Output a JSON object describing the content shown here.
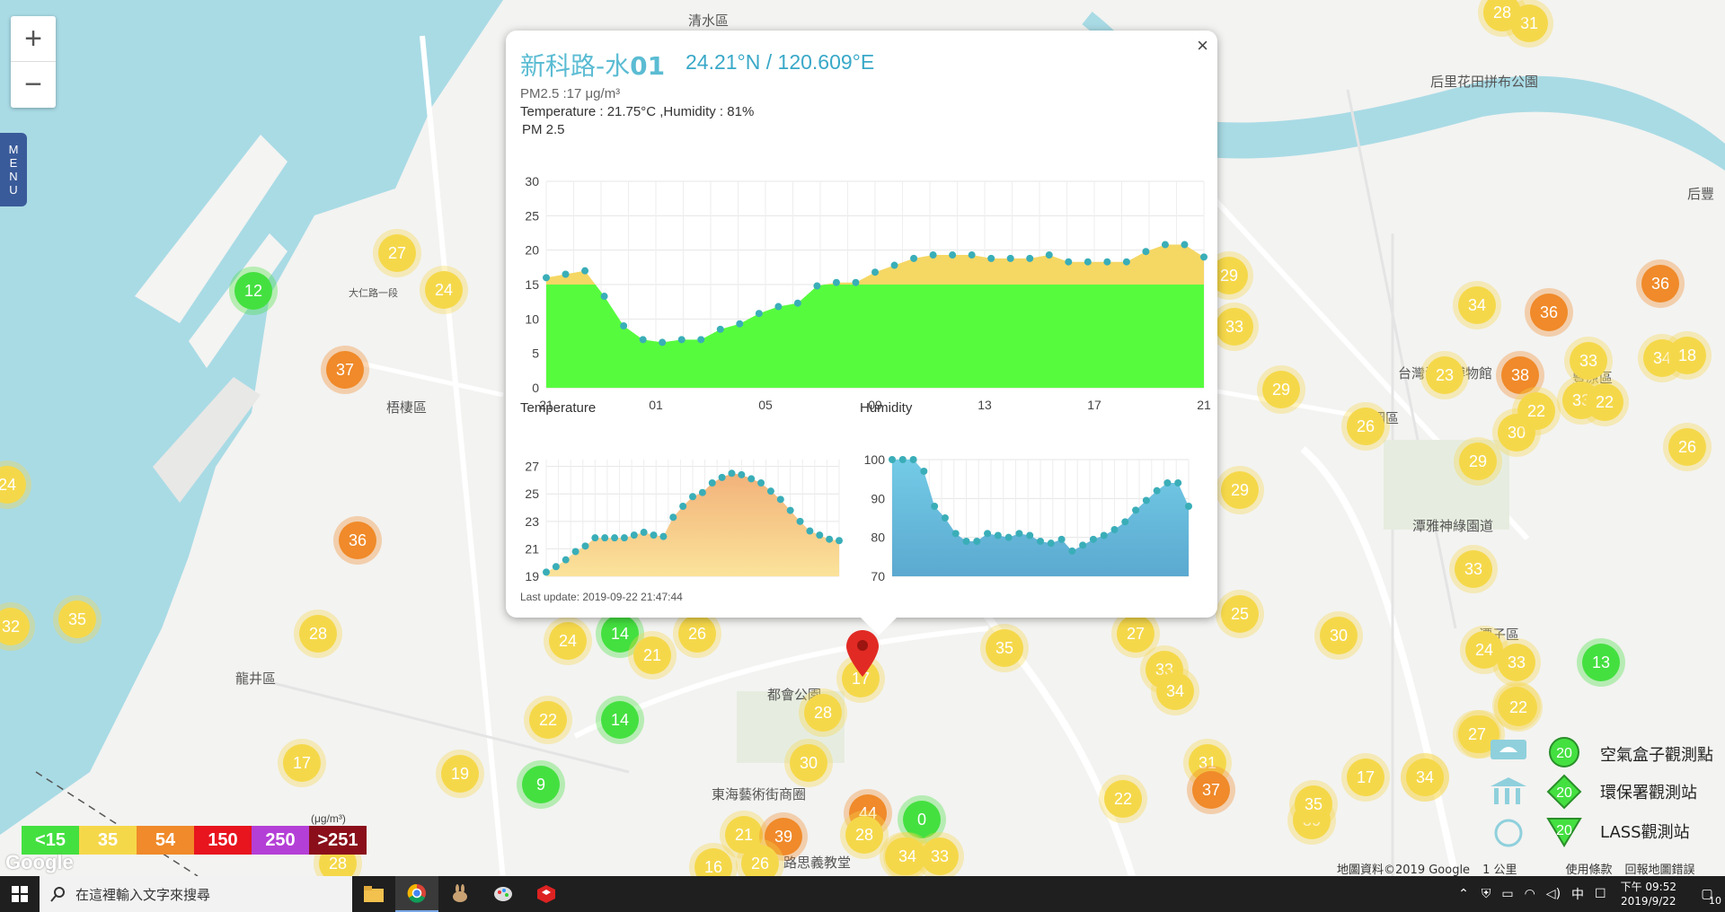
{
  "map": {
    "zoom_in": "+",
    "zoom_out": "−",
    "menu_letters": [
      "M",
      "E",
      "N",
      "U"
    ],
    "places": [
      {
        "name": "清水區"
      },
      {
        "name": "梧棲區"
      },
      {
        "name": "龍井區"
      },
      {
        "name": "都會公園"
      },
      {
        "name": "東海藝術街商圈"
      },
      {
        "name": "后里花田拼布公園"
      },
      {
        "name": "神岡區"
      },
      {
        "name": "潭雅神綠園道"
      },
      {
        "name": "潭子區"
      },
      {
        "name": "台灣滑翔博物館"
      },
      {
        "name": "豐原區"
      },
      {
        "name": "后豐"
      },
      {
        "name": "大仁路一段"
      },
      {
        "name": "路思義教堂"
      }
    ],
    "legend": {
      "unit": "(μg/m³)",
      "items": [
        {
          "label": "<15",
          "color": "#44e040"
        },
        {
          "label": "35",
          "color": "#f5d84a"
        },
        {
          "label": "54",
          "color": "#f08a2a"
        },
        {
          "label": "150",
          "color": "#e8141e"
        },
        {
          "label": "250",
          "color": "#b43fd6"
        },
        {
          "label": ">251",
          "color": "#8a0f1a"
        }
      ]
    },
    "station_legend": {
      "items": [
        {
          "value": "20",
          "label": "空氣盒子觀測點"
        },
        {
          "value": "20",
          "label": "環保署觀測站"
        },
        {
          "value": "20",
          "label": "LASS觀測站"
        }
      ]
    },
    "attribution": "Google",
    "map_data": "地圖資料©2019 Google",
    "scale": "1 公里",
    "terms": "使用條款",
    "report": "回報地圖錯誤",
    "markers": [
      {
        "v": "31",
        "c": "y"
      },
      {
        "v": "28",
        "c": "y"
      },
      {
        "v": "27",
        "c": "y"
      },
      {
        "v": "24",
        "c": "y"
      },
      {
        "v": "12",
        "c": "g"
      },
      {
        "v": "37",
        "c": "o"
      },
      {
        "v": "24",
        "c": "y"
      },
      {
        "v": "36",
        "c": "o"
      },
      {
        "v": "32",
        "c": "y"
      },
      {
        "v": "35",
        "c": "y"
      },
      {
        "v": "28",
        "c": "y"
      },
      {
        "v": "17",
        "c": "y"
      },
      {
        "v": "28",
        "c": "y"
      },
      {
        "v": "24",
        "c": "y"
      },
      {
        "v": "14",
        "c": "g"
      },
      {
        "v": "21",
        "c": "y"
      },
      {
        "v": "26",
        "c": "y"
      },
      {
        "v": "22",
        "c": "y"
      },
      {
        "v": "14",
        "c": "g"
      },
      {
        "v": "19",
        "c": "y"
      },
      {
        "v": "9",
        "c": "g"
      },
      {
        "v": "17",
        "c": "y"
      },
      {
        "v": "28",
        "c": "y"
      },
      {
        "v": "30",
        "c": "y"
      },
      {
        "v": "21",
        "c": "y"
      },
      {
        "v": "39",
        "c": "o"
      },
      {
        "v": "44",
        "c": "o"
      },
      {
        "v": "28",
        "c": "y"
      },
      {
        "v": "0",
        "c": "g"
      },
      {
        "v": "33",
        "c": "y"
      },
      {
        "v": "34",
        "c": "y"
      },
      {
        "v": "33",
        "c": "y"
      },
      {
        "v": "26",
        "c": "y"
      },
      {
        "v": "16",
        "c": "y"
      },
      {
        "v": "35",
        "c": "y"
      },
      {
        "v": "27",
        "c": "y"
      },
      {
        "v": "33",
        "c": "y"
      },
      {
        "v": "34",
        "c": "y"
      },
      {
        "v": "25",
        "c": "y"
      },
      {
        "v": "31",
        "c": "y"
      },
      {
        "v": "37",
        "c": "o"
      },
      {
        "v": "22",
        "c": "y"
      },
      {
        "v": "30",
        "c": "y"
      },
      {
        "v": "35",
        "c": "y"
      },
      {
        "v": "17",
        "c": "y"
      },
      {
        "v": "34",
        "c": "y"
      },
      {
        "v": "27",
        "c": "y"
      },
      {
        "v": "22",
        "c": "y"
      },
      {
        "v": "29",
        "c": "y"
      },
      {
        "v": "33",
        "c": "y"
      },
      {
        "v": "34",
        "c": "y"
      },
      {
        "v": "36",
        "c": "o"
      },
      {
        "v": "23",
        "c": "y"
      },
      {
        "v": "29",
        "c": "y"
      },
      {
        "v": "36",
        "c": "o"
      },
      {
        "v": "34",
        "c": "y"
      },
      {
        "v": "38",
        "c": "o"
      },
      {
        "v": "33",
        "c": "y"
      },
      {
        "v": "33",
        "c": "y"
      },
      {
        "v": "22",
        "c": "y"
      },
      {
        "v": "18",
        "c": "y"
      },
      {
        "v": "26",
        "c": "y"
      },
      {
        "v": "30",
        "c": "y"
      },
      {
        "v": "22",
        "c": "y"
      },
      {
        "v": "29",
        "c": "y"
      },
      {
        "v": "29",
        "c": "y"
      },
      {
        "v": "26",
        "c": "y"
      },
      {
        "v": "33",
        "c": "y"
      },
      {
        "v": "24",
        "c": "y"
      },
      {
        "v": "33",
        "c": "y"
      },
      {
        "v": "13",
        "c": "g"
      },
      {
        "v": "22",
        "c": "y"
      },
      {
        "v": "27",
        "c": "y"
      },
      {
        "v": "34",
        "c": "y"
      },
      {
        "v": "30",
        "c": "y"
      }
    ]
  },
  "popup": {
    "name": "新科路-水",
    "name_bold": "01",
    "coords": "24.21°N / 120.609°E",
    "pm_line": "PM2.5 :17 μg/m³",
    "th_line": "Temperature : 21.75°C ,Humidity : 81%",
    "close": "×",
    "last_update": "Last update: 2019-09-22 21:47:44",
    "pm_chart_label": "PM 2.5",
    "temp_chart_label": "Temperature",
    "hum_chart_label": "Humidity"
  },
  "chart_data": [
    {
      "type": "area",
      "title": "PM 2.5",
      "x_tick_labels": [
        "21",
        "01",
        "05",
        "09",
        "13",
        "17",
        "21"
      ],
      "y_ticks": [
        0,
        5,
        10,
        15,
        20,
        25,
        30
      ],
      "ylim": [
        0,
        30
      ],
      "threshold": 15,
      "colors": {
        "below": "#57fb3e",
        "above": "#f5d764",
        "points": "#3aaeb8"
      },
      "values": [
        16,
        16.5,
        17,
        13.3,
        9,
        7,
        6.6,
        7,
        7,
        8.5,
        9.3,
        10.8,
        11.8,
        12.3,
        14.8,
        15.3,
        15.3,
        16.8,
        17.8,
        18.8,
        19.3,
        19.3,
        19.3,
        18.8,
        18.8,
        18.8,
        19.3,
        18.3,
        18.3,
        18.3,
        18.3,
        19.8,
        20.8,
        20.8,
        19
      ]
    },
    {
      "type": "area",
      "title": "Temperature",
      "y_ticks": [
        19,
        21,
        23,
        25,
        27
      ],
      "ylim": [
        19,
        27.5
      ],
      "colors": {
        "fill_top": "#f2b27a",
        "fill_bottom": "#fbe39a",
        "points": "#3aaeb8"
      },
      "values": [
        19.3,
        19.7,
        20.2,
        20.8,
        21.2,
        21.8,
        21.8,
        21.8,
        21.8,
        22,
        22.2,
        22,
        21.9,
        23.3,
        24.1,
        24.8,
        25.1,
        25.8,
        26.2,
        26.5,
        26.4,
        26.1,
        25.8,
        25.2,
        24.6,
        23.8,
        23.0,
        22.3,
        22,
        21.7,
        21.6
      ]
    },
    {
      "type": "area",
      "title": "Humidity",
      "y_ticks": [
        70,
        80,
        90,
        100
      ],
      "ylim": [
        70,
        100
      ],
      "colors": {
        "fill_top": "#73cbe6",
        "fill_bottom": "#5ba9d0",
        "points": "#3aaeb8"
      },
      "values": [
        100,
        100,
        100,
        97,
        88,
        85,
        81,
        79,
        79,
        81,
        80.5,
        80,
        81,
        80.5,
        79,
        78.5,
        79.5,
        76.5,
        78,
        79.5,
        80.5,
        82,
        84,
        87,
        89.5,
        92,
        94,
        94,
        88
      ]
    }
  ],
  "taskbar": {
    "search_placeholder": "在這裡輸入文字來搜尋",
    "ime": "中",
    "time": "下午 09:52",
    "date": "2019/9/22",
    "notif_count": "10"
  }
}
